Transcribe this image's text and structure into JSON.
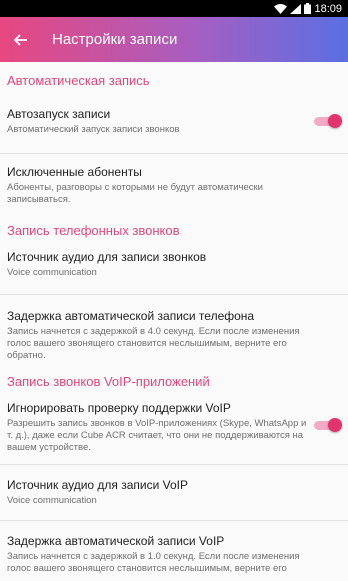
{
  "status_bar": {
    "time": "18:09"
  },
  "app_bar": {
    "title": "Настройки записи"
  },
  "sections": {
    "auto": {
      "header": "Автоматическая запись"
    },
    "phone": {
      "header": "Запись телефонных звонков"
    },
    "voip": {
      "header": "Запись звонков VoIP-приложений"
    }
  },
  "prefs": {
    "autostart": {
      "title": "Автозапуск записи",
      "summary": "Автоматический запуск записи звонков",
      "enabled": true
    },
    "excluded": {
      "title": "Исключенные абоненты",
      "summary": "Абоненты, разговоры с которыми не будут автоматически записываться."
    },
    "audio_source": {
      "title": "Источник аудио для записи звонков",
      "summary": "Voice communication"
    },
    "delay_phone": {
      "title": "Задержка автоматической записи телефона",
      "summary": "Запись начнется с задержкой в 4.0 секунд. Если после изменения голос вашего звонящего становится неслышимым, верните его обратно."
    },
    "ignore_voip": {
      "title": "Игнорировать проверку поддержки VoIP",
      "summary": "Разрешить запись звонков в VoIP-приложениях (Skype, WhatsApp и т. д.), даже если Cube ACR считает, что они не поддерживаются на вашем устройстве.",
      "enabled": true
    },
    "voip_source": {
      "title": "Источник аудио для записи VoIP",
      "summary": "Voice communication"
    },
    "delay_voip": {
      "title": "Задержка автоматической записи VoIP",
      "summary": "Запись начнется с задержкой в 1.0 секунд. Если после изменения голос вашего звонящего становится неслышимым, верните его"
    }
  },
  "colors": {
    "accent": "#e2477b",
    "appbar_start": "#e8477f",
    "appbar_end": "#5a6fe2"
  },
  "icons": [
    "wifi-icon",
    "signal-icon",
    "battery-icon",
    "back-arrow-icon"
  ]
}
